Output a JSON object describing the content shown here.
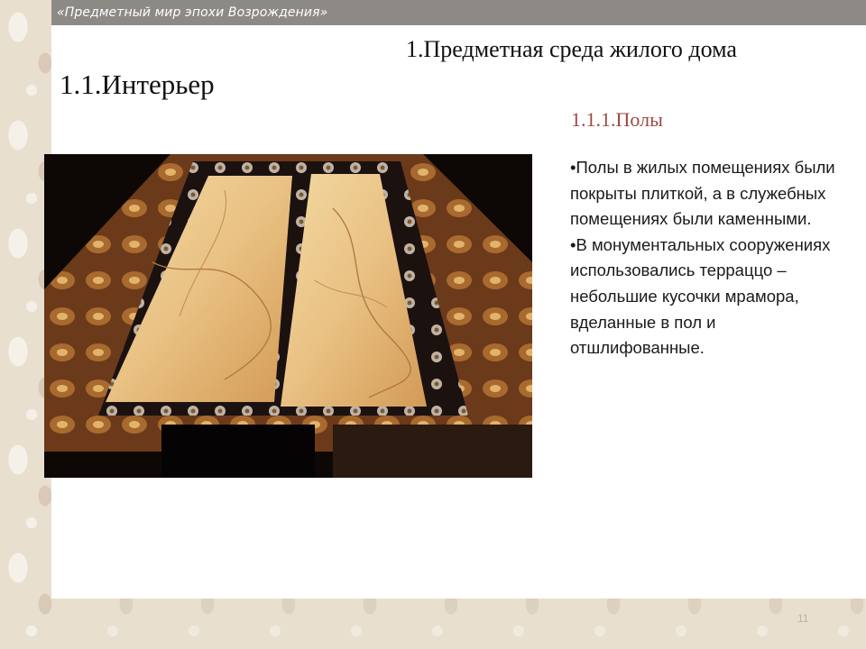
{
  "slide": {
    "header": "«Предметный мир эпохи Возрождения»",
    "section_title": "1.Предметная среда жилого дома",
    "sub_title": "1.1.Интерьер",
    "sub_sub_title": "1.1.1.Полы",
    "bullets": [
      "•Полы в жилых помещениях были покрыты плиткой, а в служебных помещениях были каменными.",
      "•В монументальных сооружениях использовались терраццо – небольшие кусочки мрамора, вделанные в пол и отшлифованные."
    ],
    "page_number": "11"
  },
  "colors": {
    "header_bar": "#8d8a86",
    "subheading": "#9b4a43",
    "background_ornament": "#e9dfcf"
  },
  "image": {
    "name": "renaissance-inlaid-marble-floor-photo"
  }
}
